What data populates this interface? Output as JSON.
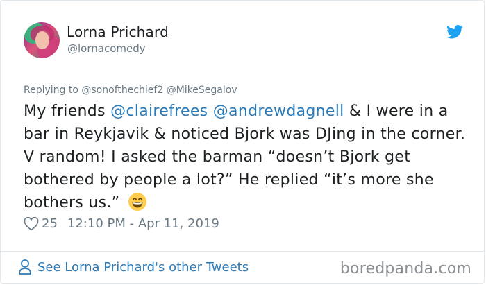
{
  "author": {
    "name": "Lorna Prichard",
    "handle": "@lornacomedy"
  },
  "replying": {
    "prefix": "Replying to",
    "targets": [
      "@sonofthechief2",
      "@MikeSegalov"
    ]
  },
  "tweet": {
    "lead": "My friends ",
    "mention1": "@clairefrees",
    "space": " ",
    "mention2": "@andrewdagnell",
    "body": " & I were in a bar in Reykjavik & noticed Bjork was DJing in the corner. V random! I asked the barman “doesn’t Bjork get bothered by people a lot?” He replied “it’s more she bothers us.” ",
    "emoji": "grinning-face-emoji"
  },
  "meta": {
    "like_count": "25",
    "timestamp": "12:10 PM - Apr 11, 2019"
  },
  "footer": {
    "link_label": "See Lorna Prichard's other Tweets",
    "watermark": "boredpanda.com"
  },
  "colors": {
    "link": "#2b7bb9",
    "muted": "#697882",
    "twitter_blue": "#1da1f2"
  },
  "icons": [
    "twitter-bird-icon",
    "heart-icon",
    "person-icon",
    "avatar"
  ]
}
